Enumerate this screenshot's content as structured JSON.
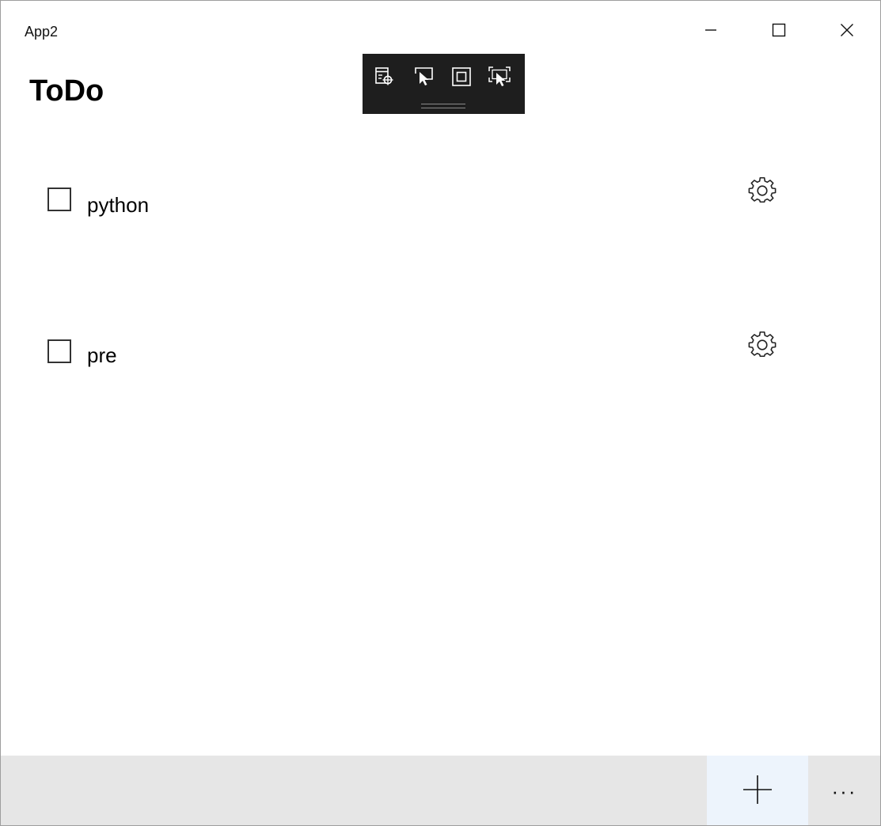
{
  "window": {
    "app_title": "App2",
    "caption": {
      "minimize_icon": "minimize-icon",
      "maximize_icon": "maximize-icon",
      "close_icon": "close-icon"
    }
  },
  "page": {
    "title": "ToDo"
  },
  "dev_toolbar": {
    "tools": [
      {
        "icon": "live-visual-tree-icon"
      },
      {
        "icon": "select-element-icon"
      },
      {
        "icon": "display-layout-adorners-icon"
      },
      {
        "icon": "track-focus-icon"
      }
    ]
  },
  "todos": [
    {
      "label": "python",
      "checked": false,
      "settings_icon": "gear-icon"
    },
    {
      "label": "pre",
      "checked": false,
      "settings_icon": "gear-icon"
    }
  ],
  "command_bar": {
    "add_icon": "plus-icon",
    "more_label": "···"
  },
  "colors": {
    "command_bar_bg": "#e6e6e6",
    "add_button_bg": "#edf4fc",
    "dev_toolbar_bg": "#1e1e1e"
  }
}
